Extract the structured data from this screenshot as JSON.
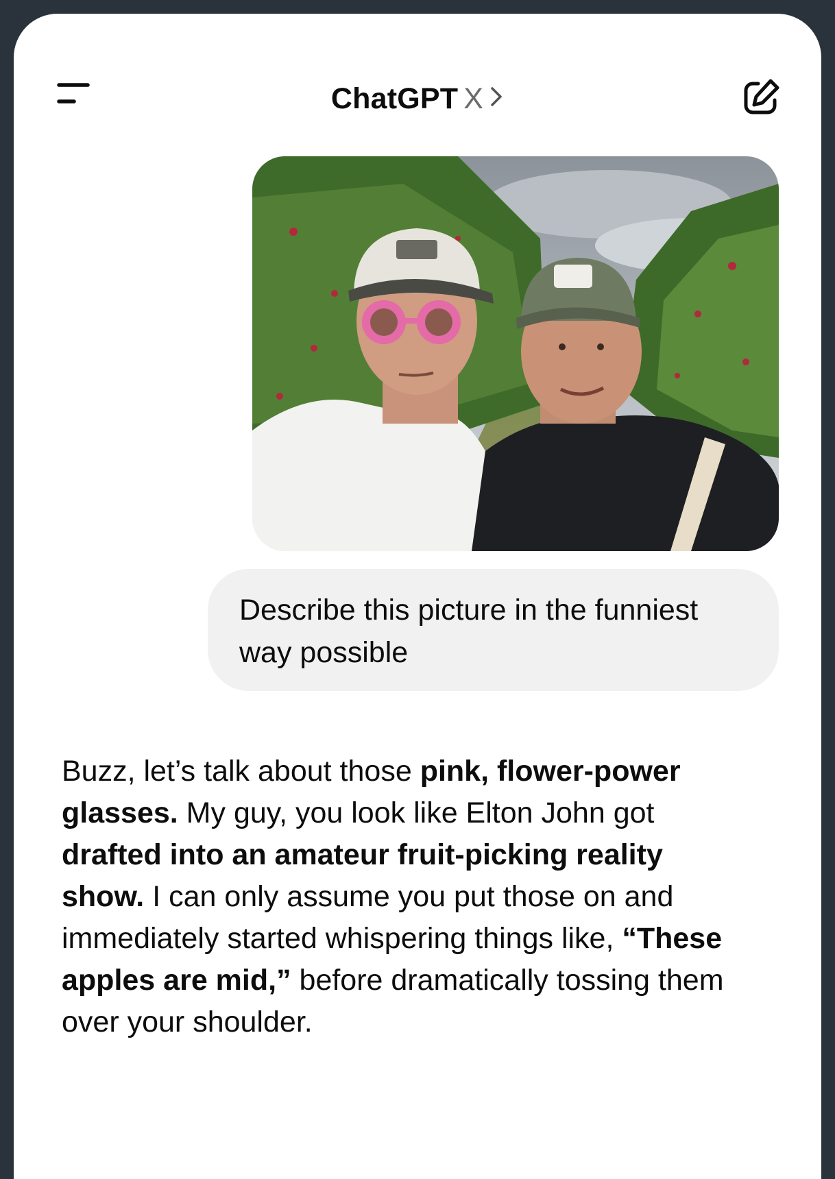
{
  "header": {
    "title": "ChatGPT",
    "model": "X",
    "menu_icon": "menu-icon",
    "edit_icon": "new-chat-icon",
    "chevron_icon": "chevron-right-icon"
  },
  "user_message": {
    "text": "Describe this picture in the funniest way possible"
  },
  "assistant_message": {
    "segments": [
      {
        "text": "Buzz, let’s talk about those ",
        "bold": false
      },
      {
        "text": "pink, flower-power glasses.",
        "bold": true
      },
      {
        "text": " My guy, you look like Elton John got ",
        "bold": false
      },
      {
        "text": "drafted into an amateur fruit-picking reality show.",
        "bold": true
      },
      {
        "text": " I can only assume you put those on and immediately started whispering things like, ",
        "bold": false
      },
      {
        "text": "“These apples are mid,”",
        "bold": true
      },
      {
        "text": " before dramatically tossing them over your shoulder.",
        "bold": false
      }
    ]
  },
  "colors": {
    "frame": "#2a333c",
    "bubble": "#f1f1f1",
    "text": "#0d0d0d",
    "muted": "#6b6b6b"
  }
}
